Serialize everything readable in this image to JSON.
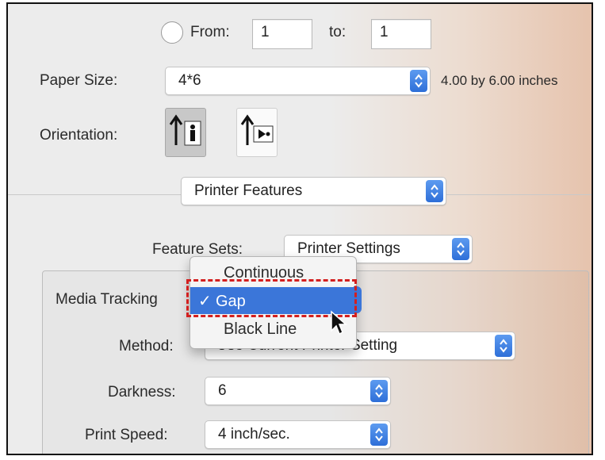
{
  "range": {
    "from_label": "From:",
    "from_value": "1",
    "to_label": "to:",
    "to_value": "1"
  },
  "paper_size": {
    "label": "Paper Size:",
    "value": "4*6",
    "dimensions": "4.00 by 6.00 inches"
  },
  "orientation": {
    "label": "Orientation:",
    "options": [
      "portrait",
      "landscape"
    ],
    "selected": "portrait"
  },
  "section_select": {
    "value": "Printer Features"
  },
  "feature_sets": {
    "label": "Feature Sets:",
    "value": "Printer Settings"
  },
  "media_tracking": {
    "label": "Media Tracking",
    "options": [
      "Continuous",
      "Gap",
      "Black Line"
    ],
    "selected": "Gap",
    "check_mark": "✓"
  },
  "method": {
    "label": "Method:",
    "value": "Use Current Printer Setting"
  },
  "darkness": {
    "label": "Darkness:",
    "value": "6"
  },
  "print_speed": {
    "label": "Print Speed:",
    "value": "4 inch/sec."
  },
  "colors": {
    "accent": "#3b76d9",
    "highlight_box": "#d31f1f"
  }
}
